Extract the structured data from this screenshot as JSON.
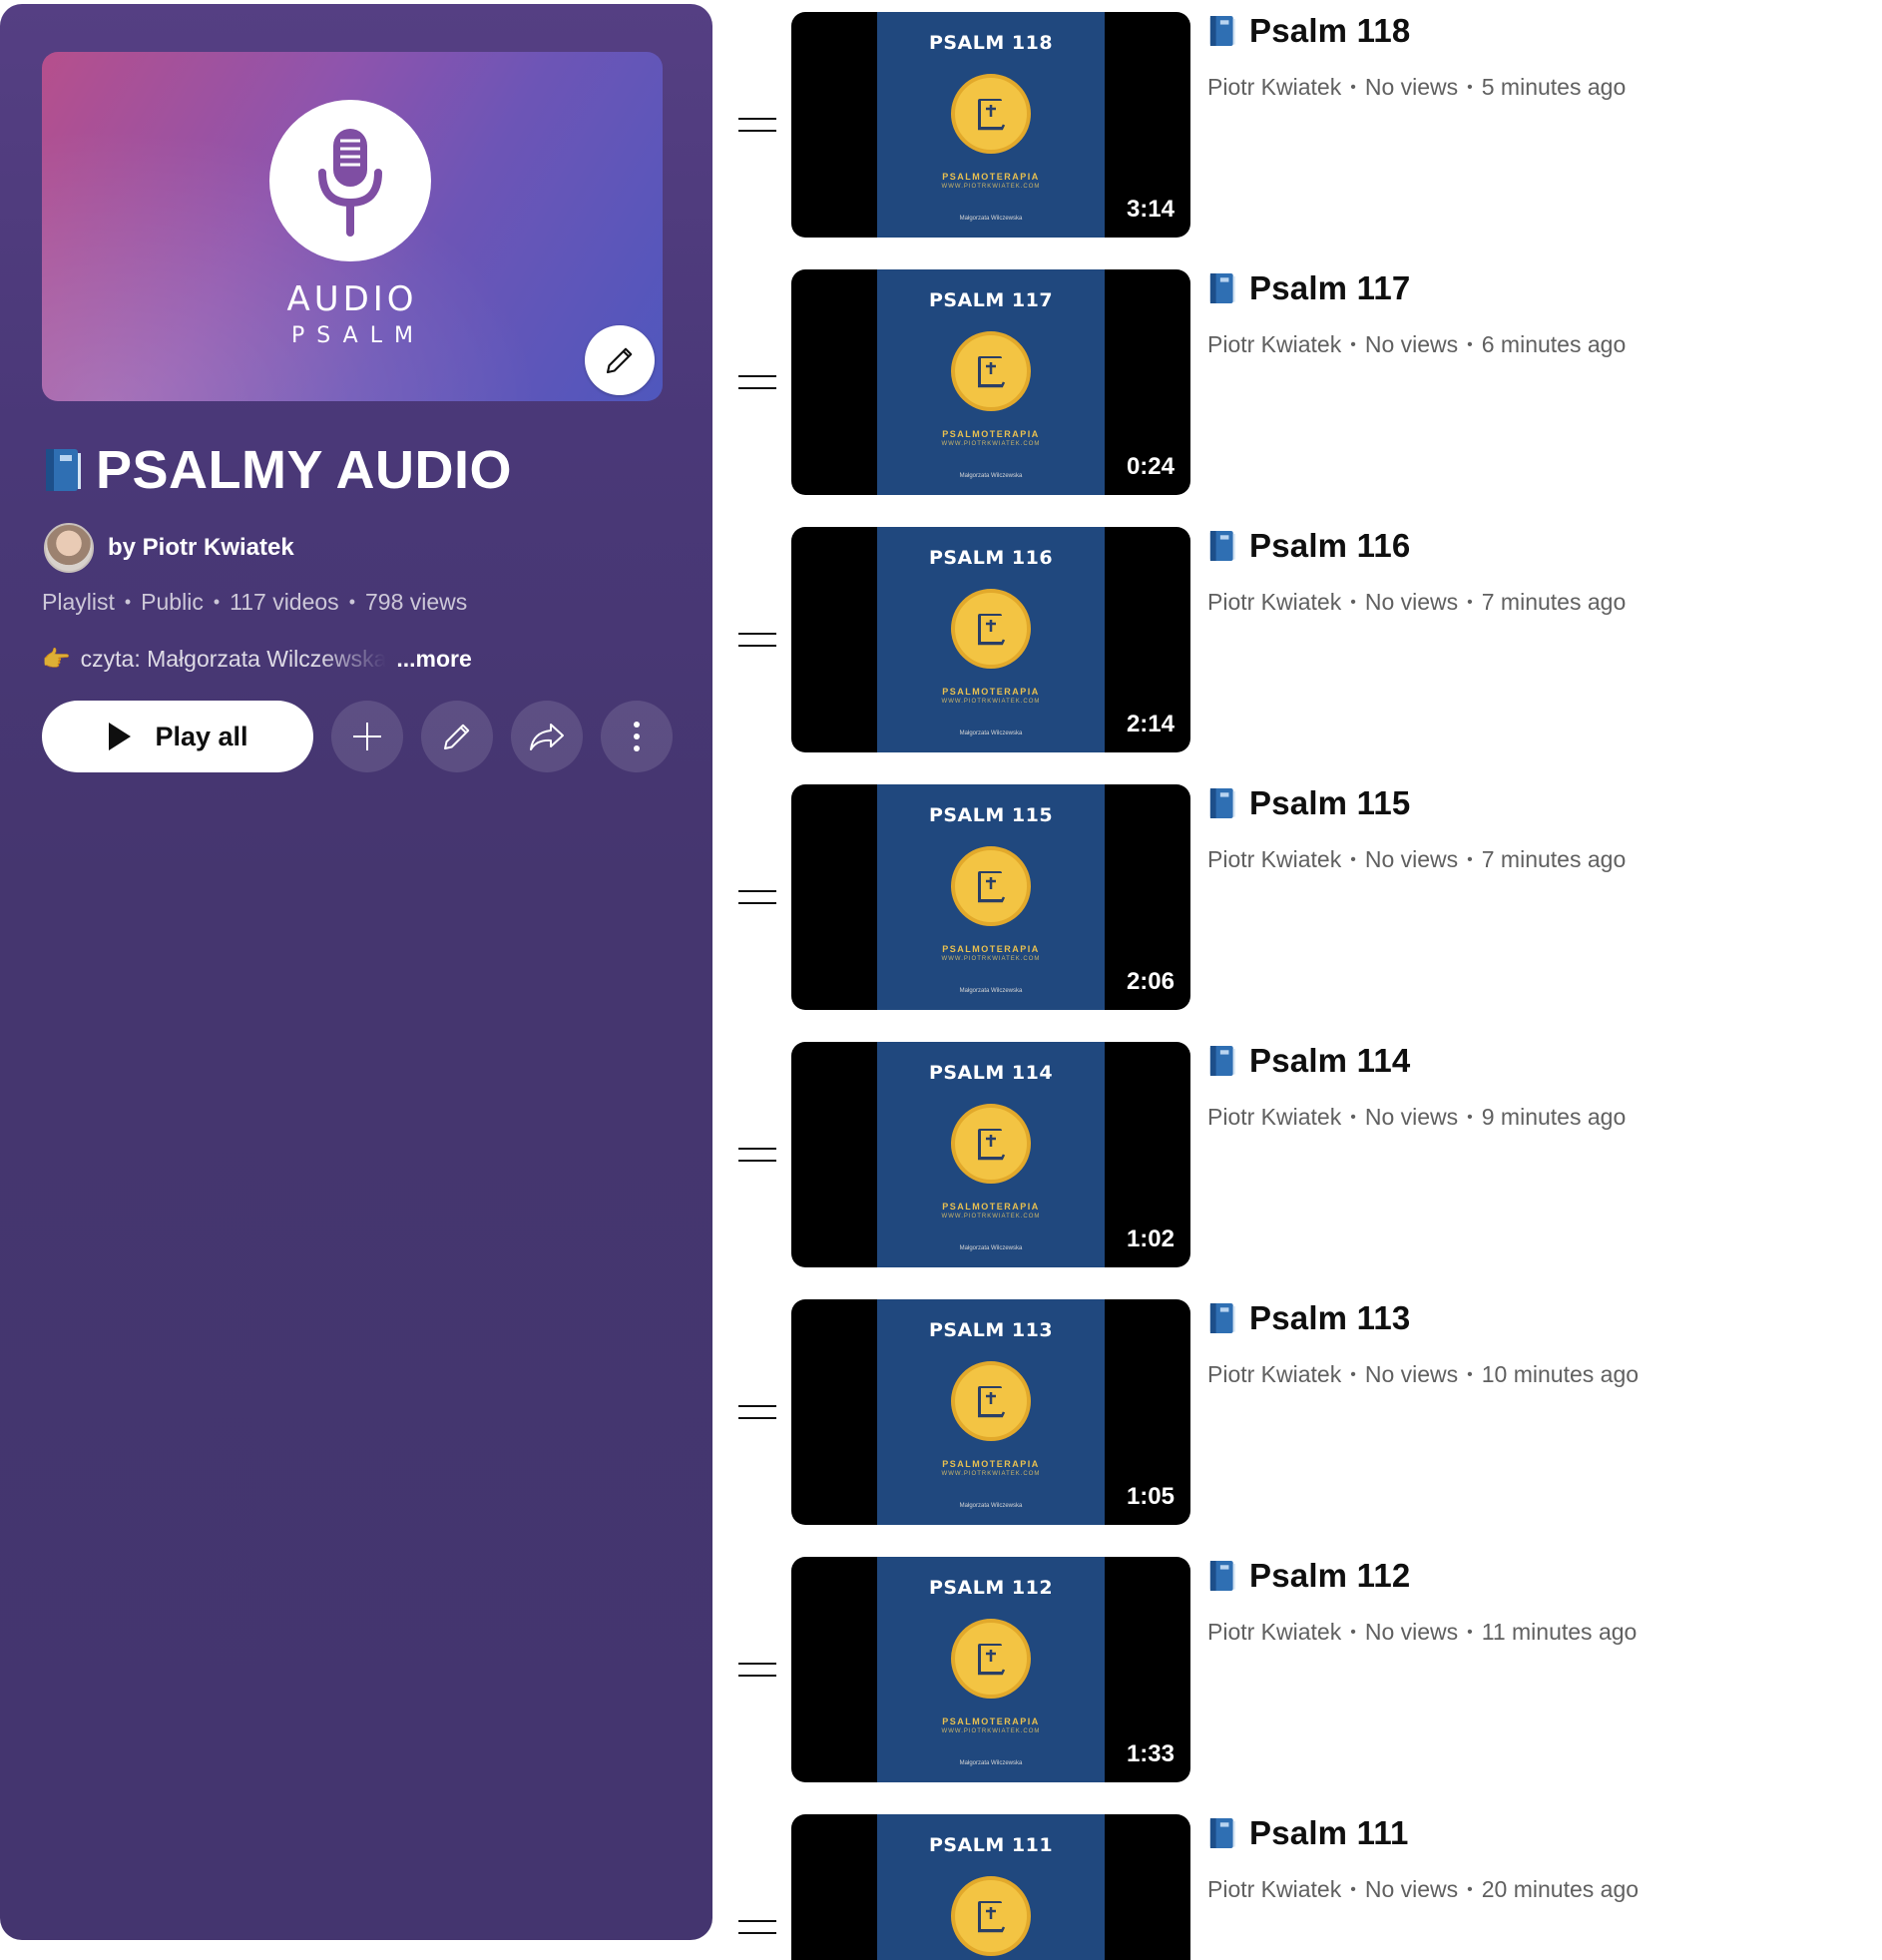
{
  "playlist": {
    "cover": {
      "title": "AUDIO",
      "subtitle": "PSALM",
      "icon": "microphone-icon",
      "edit_icon": "pencil-icon"
    },
    "title_icon": "blue-book-icon",
    "title": "PSALMY AUDIO",
    "owner": "by Piotr Kwiatek",
    "meta": {
      "type": "Playlist",
      "visibility": "Public",
      "videos": "117 videos",
      "views": "798 views"
    },
    "description_emoji": "👉",
    "description": "czyta: Małgorzata Wilczewska",
    "more_label": "...more",
    "actions": {
      "play_all": "Play all",
      "add_icon": "plus-icon",
      "edit_icon": "pencil-icon",
      "share_icon": "share-arrow-icon",
      "more_icon": "more-vertical-icon"
    },
    "colors": {
      "panel": "#45366f",
      "cover_start": "#b64f8c",
      "cover_end": "#4f57bd"
    }
  },
  "videos": [
    {
      "title": "Psalm 118",
      "thumb_label": "PSALM 118",
      "duration": "3:14",
      "channel": "Piotr Kwiatek",
      "views": "No views",
      "age": "5 minutes ago"
    },
    {
      "title": "Psalm 117",
      "thumb_label": "PSALM 117",
      "duration": "0:24",
      "channel": "Piotr Kwiatek",
      "views": "No views",
      "age": "6 minutes ago"
    },
    {
      "title": "Psalm 116",
      "thumb_label": "PSALM 116",
      "duration": "2:14",
      "channel": "Piotr Kwiatek",
      "views": "No views",
      "age": "7 minutes ago"
    },
    {
      "title": "Psalm 115",
      "thumb_label": "PSALM 115",
      "duration": "2:06",
      "channel": "Piotr Kwiatek",
      "views": "No views",
      "age": "7 minutes ago"
    },
    {
      "title": "Psalm 114",
      "thumb_label": "PSALM 114",
      "duration": "1:02",
      "channel": "Piotr Kwiatek",
      "views": "No views",
      "age": "9 minutes ago"
    },
    {
      "title": "Psalm 113",
      "thumb_label": "PSALM 113",
      "duration": "1:05",
      "channel": "Piotr Kwiatek",
      "views": "No views",
      "age": "10 minutes ago"
    },
    {
      "title": "Psalm 112",
      "thumb_label": "PSALM 112",
      "duration": "1:33",
      "channel": "Piotr Kwiatek",
      "views": "No views",
      "age": "11 minutes ago"
    },
    {
      "title": "Psalm 111",
      "thumb_label": "PSALM 111",
      "duration": "",
      "channel": "Piotr Kwiatek",
      "views": "No views",
      "age": "20 minutes ago"
    }
  ],
  "thumbnail": {
    "brand": "PSALMOTERAPIA",
    "url": "WWW.PIOTRKWIATEK.COM",
    "reader": "Małgorzata Wilczewska"
  }
}
